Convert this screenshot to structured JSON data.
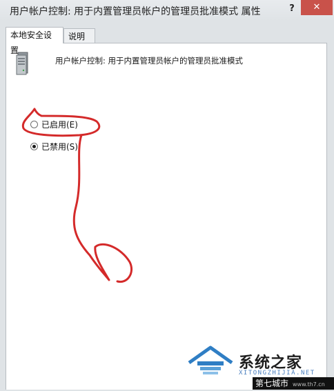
{
  "window": {
    "title": "用户帐户控制: 用于内置管理员帐户的管理员批准模式 属性",
    "help_label": "?",
    "close_label": "✕"
  },
  "tabs": [
    {
      "label": "本地安全设置",
      "active": true
    },
    {
      "label": "说明",
      "active": false
    }
  ],
  "policy": {
    "title": "用户帐户控制: 用于内置管理员帐户的管理员批准模式",
    "icon": "server-icon"
  },
  "options": [
    {
      "label": "已启用(E)",
      "checked": false
    },
    {
      "label": "已禁用(S)",
      "checked": true
    }
  ],
  "annotation": {
    "color": "#d42a2a"
  },
  "watermark": {
    "name_cn": "系统之家",
    "name_en": "XITONGZHIJIA.NET",
    "footer": "第七城市",
    "footer_url": "www.th7.cn"
  },
  "colors": {
    "close": "#c9524a",
    "accent": "#2f7ec4"
  }
}
